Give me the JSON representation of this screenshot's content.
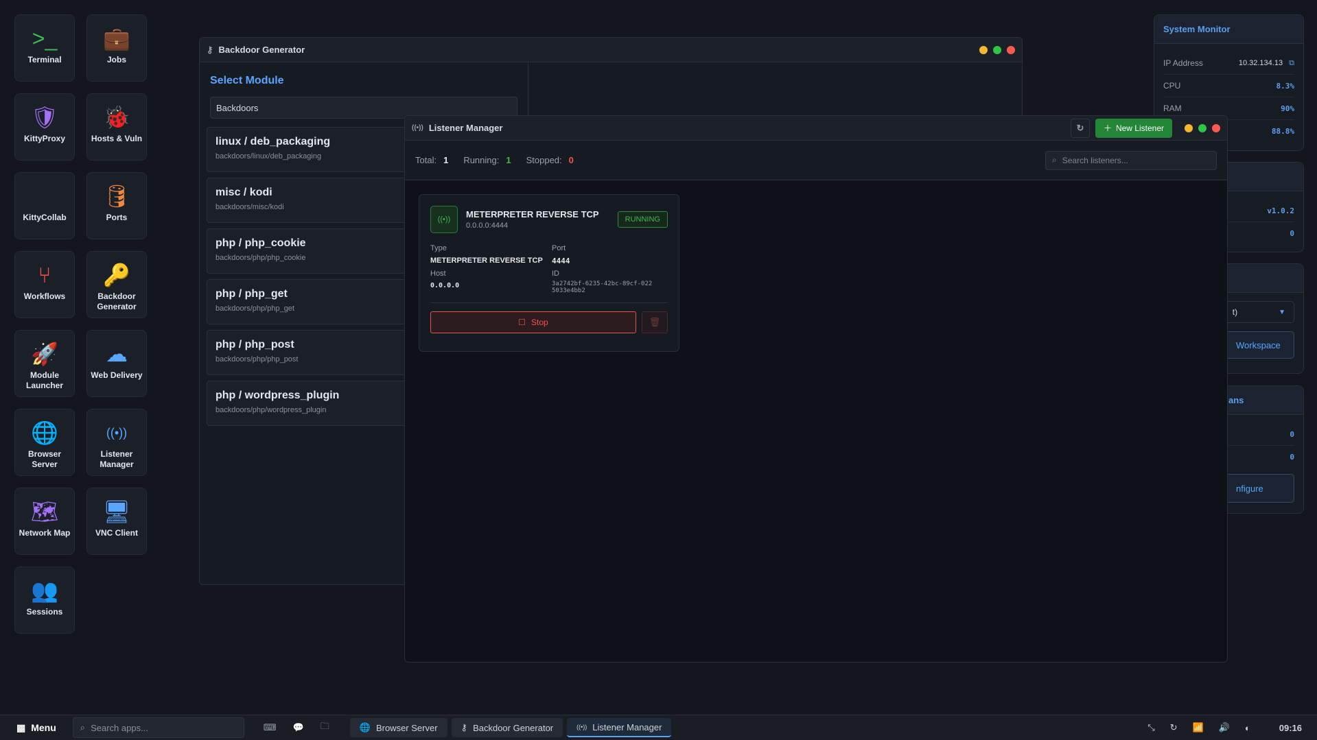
{
  "desktop": [
    {
      "label": "Terminal",
      "icon": "terminal-icon",
      "glyph": ">_",
      "color": "#3fb950"
    },
    {
      "label": "Jobs",
      "icon": "briefcase-icon",
      "glyph": "💼",
      "color": "#f0883e"
    },
    {
      "label": "KittyProxy",
      "icon": "shield-icon",
      "glyph": "🛡",
      "color": "#a371f7"
    },
    {
      "label": "Hosts & Vuln",
      "icon": "bug-icon",
      "glyph": "🐞",
      "color": "#58a6ff"
    },
    {
      "label": "KittyCollab",
      "icon": "code-icon",
      "glyph": "</>",
      "color": "#79c0ff"
    },
    {
      "label": "Ports",
      "icon": "database-icon",
      "glyph": "🛢",
      "color": "#f0883e"
    },
    {
      "label": "Workflows",
      "icon": "git-branch-icon",
      "glyph": "⑂",
      "color": "#f85149"
    },
    {
      "label": "Backdoor Generator",
      "icon": "key-icon",
      "glyph": "🔑",
      "color": "#58a6ff"
    },
    {
      "label": "Module Launcher",
      "icon": "rocket-icon",
      "glyph": "🚀",
      "color": "#3fb950"
    },
    {
      "label": "Web Delivery",
      "icon": "cloud-download-icon",
      "glyph": "☁",
      "color": "#58a6ff"
    },
    {
      "label": "Browser Server",
      "icon": "globe-icon",
      "glyph": "🌐",
      "color": "#58a6ff"
    },
    {
      "label": "Listener Manager",
      "icon": "broadcast-icon",
      "glyph": "((•))",
      "color": "#58a6ff"
    },
    {
      "label": "Network Map",
      "icon": "map-icon",
      "glyph": "🗺",
      "color": "#a371f7"
    },
    {
      "label": "VNC Client",
      "icon": "monitor-icon",
      "glyph": "🖥",
      "color": "#58a6ff"
    },
    {
      "label": "Sessions",
      "icon": "users-icon",
      "glyph": "👥",
      "color": "#3fb950"
    }
  ],
  "backdoor": {
    "title": "Backdoor Generator",
    "heading": "Select Module",
    "category": "Backdoors",
    "modules": [
      {
        "name": "linux / deb_packaging",
        "path": "backdoors/linux/deb_packaging"
      },
      {
        "name": "misc / kodi",
        "path": "backdoors/misc/kodi"
      },
      {
        "name": "php / php_cookie",
        "path": "backdoors/php/php_cookie"
      },
      {
        "name": "php / php_get",
        "path": "backdoors/php/php_get"
      },
      {
        "name": "php / php_post",
        "path": "backdoors/php/php_post"
      },
      {
        "name": "php / wordpress_plugin",
        "path": "backdoors/php/wordpress_plugin"
      }
    ]
  },
  "listener": {
    "title": "Listener Manager",
    "new_label": "New Listener",
    "search_placeholder": "Search listeners...",
    "stats": {
      "total_label": "Total:",
      "total": "1",
      "running_label": "Running:",
      "running": "1",
      "stopped_label": "Stopped:",
      "stopped": "0"
    },
    "card": {
      "name": "METERPRETER REVERSE TCP",
      "addr": "0.0.0.0:4444",
      "status": "RUNNING",
      "type_label": "Type",
      "type": "METERPRETER REVERSE TCP",
      "port_label": "Port",
      "port": "4444",
      "host_label": "Host",
      "host": "0.0.0.0",
      "id_label": "ID",
      "id": "3a2742bf-6235-42bc-89cf-0225033e4bb2",
      "stop_label": "Stop"
    }
  },
  "sysmon": {
    "title": "System Monitor",
    "ip_label": "IP Address",
    "ip": "10.32.134.13",
    "cpu_label": "CPU",
    "cpu": "8.3%",
    "ram_label": "RAM",
    "ram": "90%",
    "disk": "88.8%"
  },
  "panel2": {
    "title": "p",
    "version": "v1.0.2",
    "count": "0"
  },
  "panel3": {
    "select": "t)",
    "button": "Workspace"
  },
  "panel4": {
    "title": "ans",
    "a": "0",
    "b": "0",
    "button": "nfigure"
  },
  "taskbar": {
    "menu": "Menu",
    "search_placeholder": "Search apps...",
    "tasks": [
      "Browser Server",
      "Backdoor Generator",
      "Listener Manager"
    ],
    "clock": "09:16"
  }
}
